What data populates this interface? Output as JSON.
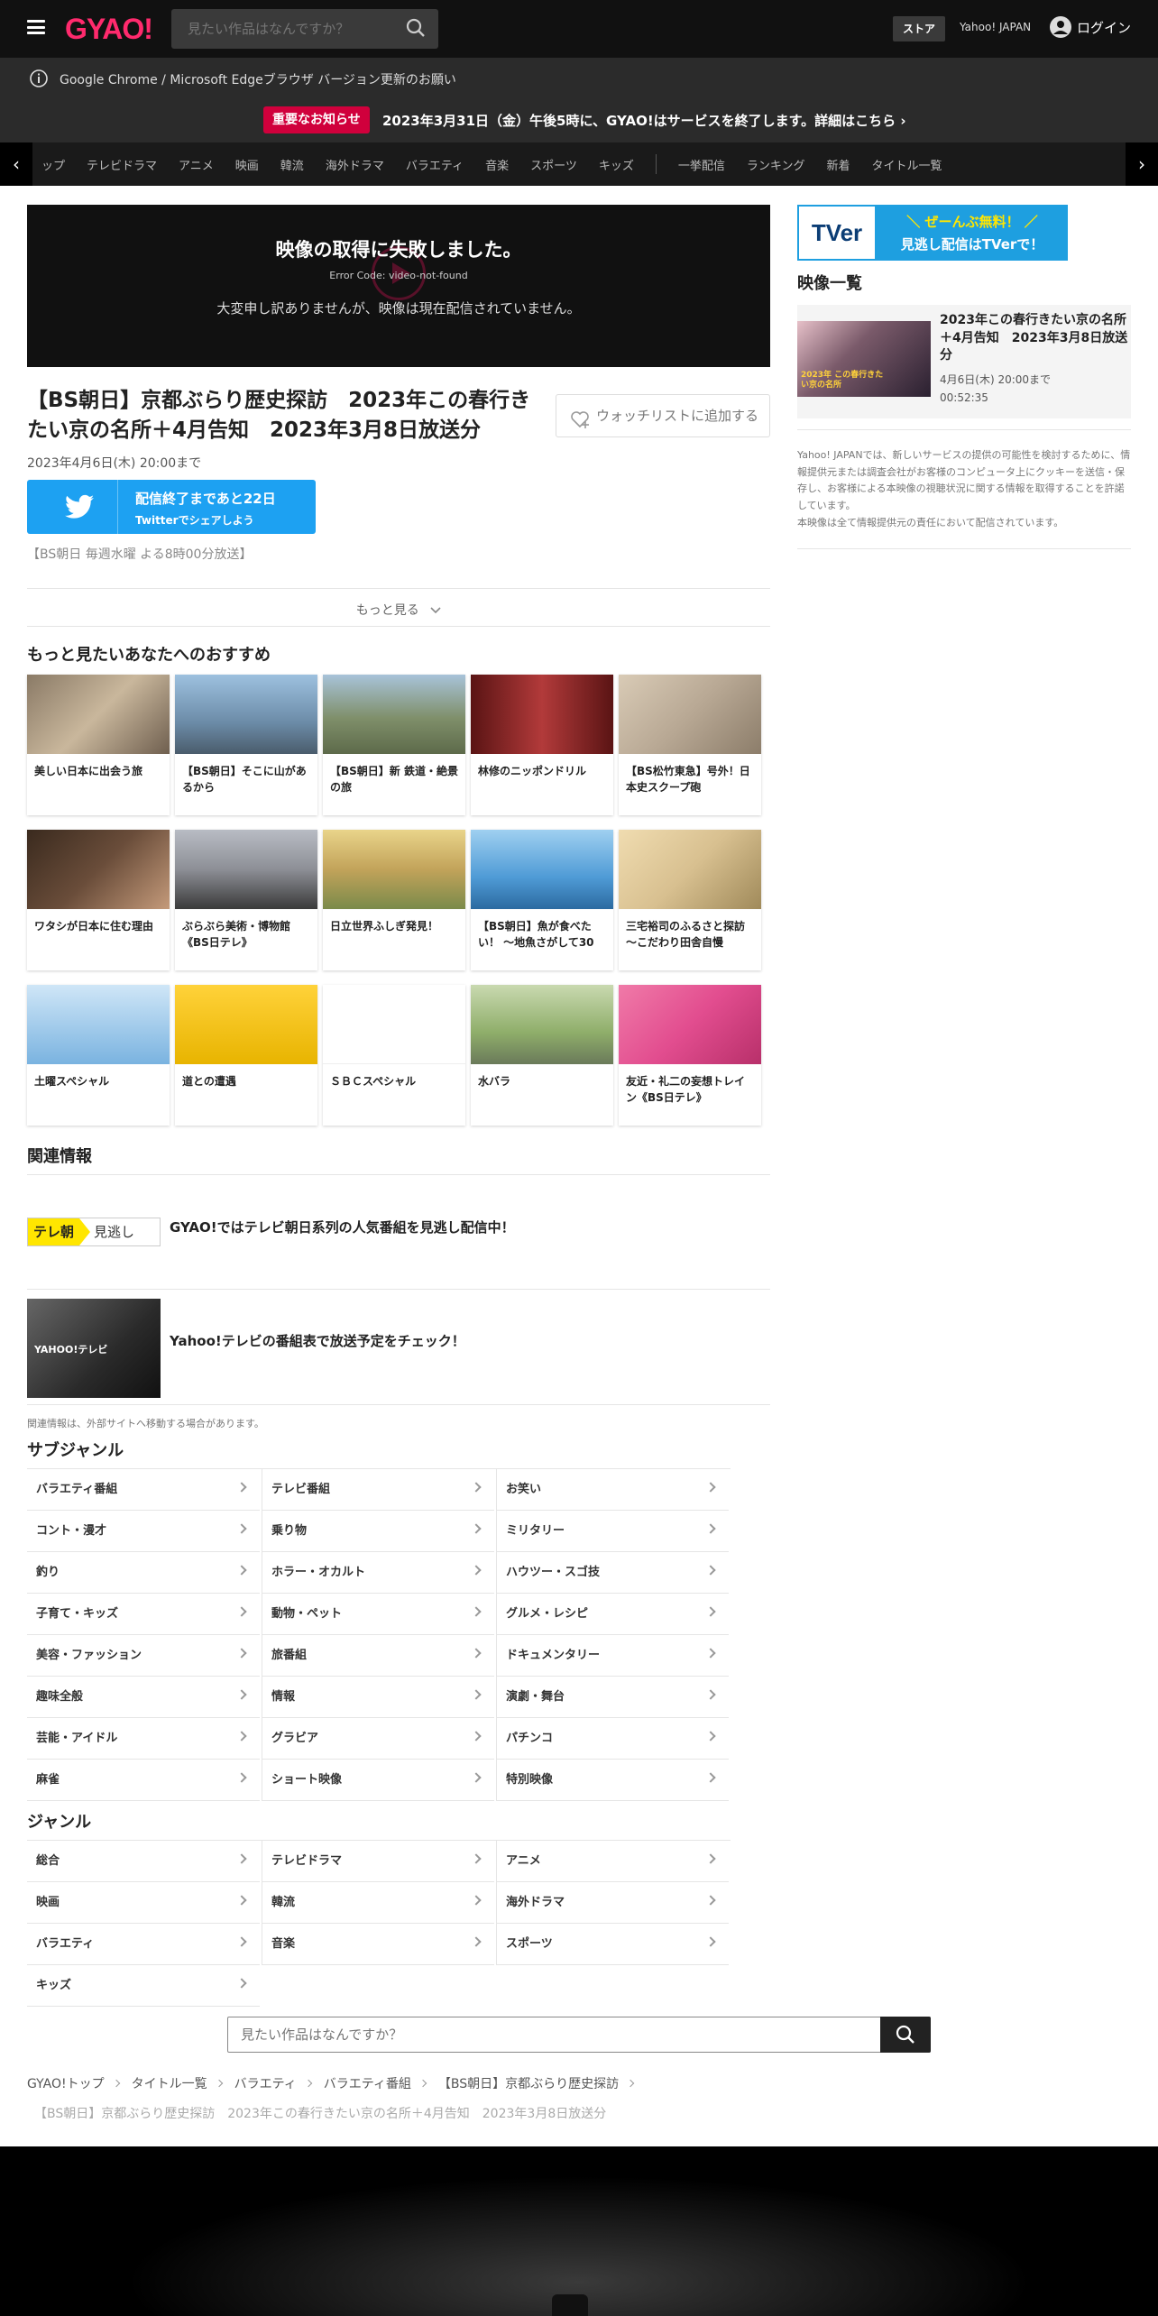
{
  "header": {
    "logo": "GYAO!",
    "search_placeholder": "見たい作品はなんですか？",
    "store": "ストア",
    "yahoo_japan": "Yahoo! JAPAN",
    "login": "ログイン"
  },
  "notice": {
    "text": "Google Chrome / Microsoft Edgeブラウザ バージョン更新のお願い"
  },
  "important": {
    "badge": "重要なお知らせ",
    "text": "2023年3月31日（金）午後5時に、GYAO!はサービスを終了します。詳細はこちら"
  },
  "nav": {
    "items": [
      "ップ",
      "テレビドラマ",
      "アニメ",
      "映画",
      "韓流",
      "海外ドラマ",
      "バラエティ",
      "音楽",
      "スポーツ",
      "キッズ"
    ],
    "items2": [
      "一挙配信",
      "ランキング",
      "新着",
      "タイトル一覧"
    ]
  },
  "player": {
    "error_title": "映像の取得に失敗しました。",
    "error_code": "Error Code: video-not-found",
    "error_message": "大変申し訳ありませんが、映像は現在配信されていません。"
  },
  "program": {
    "title": "【BS朝日】京都ぶらり歴史探訪　2023年この春行きたい京の名所＋4月告知　2023年3月8日放送分",
    "watchlist": "ウォッチリストに追加する",
    "deadline": "2023年4月6日(木) 20:00まで",
    "twitter_days": "配信終了まであと22日",
    "twitter_share": "Twitterでシェアしよう",
    "schedule": "【BS朝日 毎週水曜 よる8時00分放送】",
    "more": "もっと見る"
  },
  "recommend": {
    "heading": "もっと見たいあなたへのおすすめ",
    "items": [
      {
        "name": "美しい日本に出会う旅",
        "color": "#8a7a66"
      },
      {
        "name": "【BS朝日】そこに山があるから",
        "color": "#6c8ca8"
      },
      {
        "name": "【BS朝日】新 鉄道・絶景の旅",
        "color": "#7f8f6a"
      },
      {
        "name": "林修のニッポンドリル",
        "color": "#8c2b2b"
      },
      {
        "name": "【BS松竹東急】号外！日本史スクープ砲",
        "color": "#b8a894"
      },
      {
        "name": "ワタシが日本に住む理由",
        "color": "#6a4d3a"
      },
      {
        "name": "ぶらぶら美術・博物館《BS日テレ》",
        "color": "#8d8f96"
      },
      {
        "name": "日立世界ふしぎ発見！",
        "color": "#c2a35a"
      },
      {
        "name": "【BS朝日】魚が食べたい！ ～地魚さがして30",
        "color": "#4f9bd6"
      },
      {
        "name": "三宅裕司のふるさと探訪～こだわり田舎自慢",
        "color": "#d8c090"
      },
      {
        "name": "土曜スペシャル",
        "color": "#7ab3e0"
      },
      {
        "name": "道との遭遇",
        "color": "#e8b400"
      },
      {
        "name": "ＳＢＣスペシャル",
        "color": "#ffffff"
      },
      {
        "name": "水バラ",
        "color": "#8fae6a"
      },
      {
        "name": "友近・礼二の妄想トレイン《BS日テレ》",
        "color": "#e24d8f"
      }
    ]
  },
  "related": {
    "heading": "関連情報",
    "item1": "GYAO!ではテレビ朝日系列の人気番組を見逃し配信中！",
    "item1_logo": "テレ朝",
    "item1_logo2": "見逃し",
    "item2": "Yahoo!テレビの番組表で放送予定をチェック！",
    "item2_logo": "YAHOO!テレビ",
    "note": "関連情報は、外部サイトへ移動する場合があります。"
  },
  "subgenre": {
    "heading": "サブジャンル",
    "items": [
      "バラエティ番組",
      "テレビ番組",
      "お笑い",
      "コント・漫才",
      "乗り物",
      "ミリタリー",
      "釣り",
      "ホラー・オカルト",
      "ハウツー・スゴ技",
      "子育て・キッズ",
      "動物・ペット",
      "グルメ・レシピ",
      "美容・ファッション",
      "旅番組",
      "ドキュメンタリー",
      "趣味全般",
      "情報",
      "演劇・舞台",
      "芸能・アイドル",
      "グラビア",
      "パチンコ",
      "麻雀",
      "ショート映像",
      "特別映像"
    ]
  },
  "genre": {
    "heading": "ジャンル",
    "items": [
      "総合",
      "テレビドラマ",
      "アニメ",
      "映画",
      "韓流",
      "海外ドラマ",
      "バラエティ",
      "音楽",
      "スポーツ",
      "キッズ"
    ]
  },
  "bottom_search": {
    "placeholder": "見たい作品はなんですか？"
  },
  "breadcrumb": {
    "items": [
      "GYAO!トップ",
      "タイトル一覧",
      "バラエティ",
      "バラエティ番組",
      "【BS朝日】京都ぶらり歴史探訪"
    ],
    "current": "【BS朝日】京都ぶらり歴史探訪　2023年この春行きたい京の名所＋4月告知　2023年3月8日放送分"
  },
  "sidebar": {
    "tver_line1": "＼ ぜーんぶ無料！ ／",
    "tver_line2": "見逃し配信はTVerで！",
    "tver_logo": "TVer",
    "heading": "映像一覧",
    "video_title": "2023年この春行きたい京の名所＋4月告知　2023年3月8日放送分",
    "video_deadline": "4月6日(木) 20:00まで",
    "video_duration": "00:52:35",
    "thumb_caption": "2023年 この春行きたい京の名所",
    "note": "Yahoo! JAPANでは、新しいサービスの提供の可能性を検討するために、情報提供元または調査会社がお客様のコンピュータ上にクッキーを送信・保存し、お客様による本映像の視聴状況に関する情報を取得することを許諾しています。\n本映像は全て情報提供元の責任において配信されています。"
  },
  "colors": {
    "brand": "#ff2a6d",
    "important": "#d0003c",
    "twitter": "#1da1f2",
    "tver": "#1e9fe0"
  }
}
